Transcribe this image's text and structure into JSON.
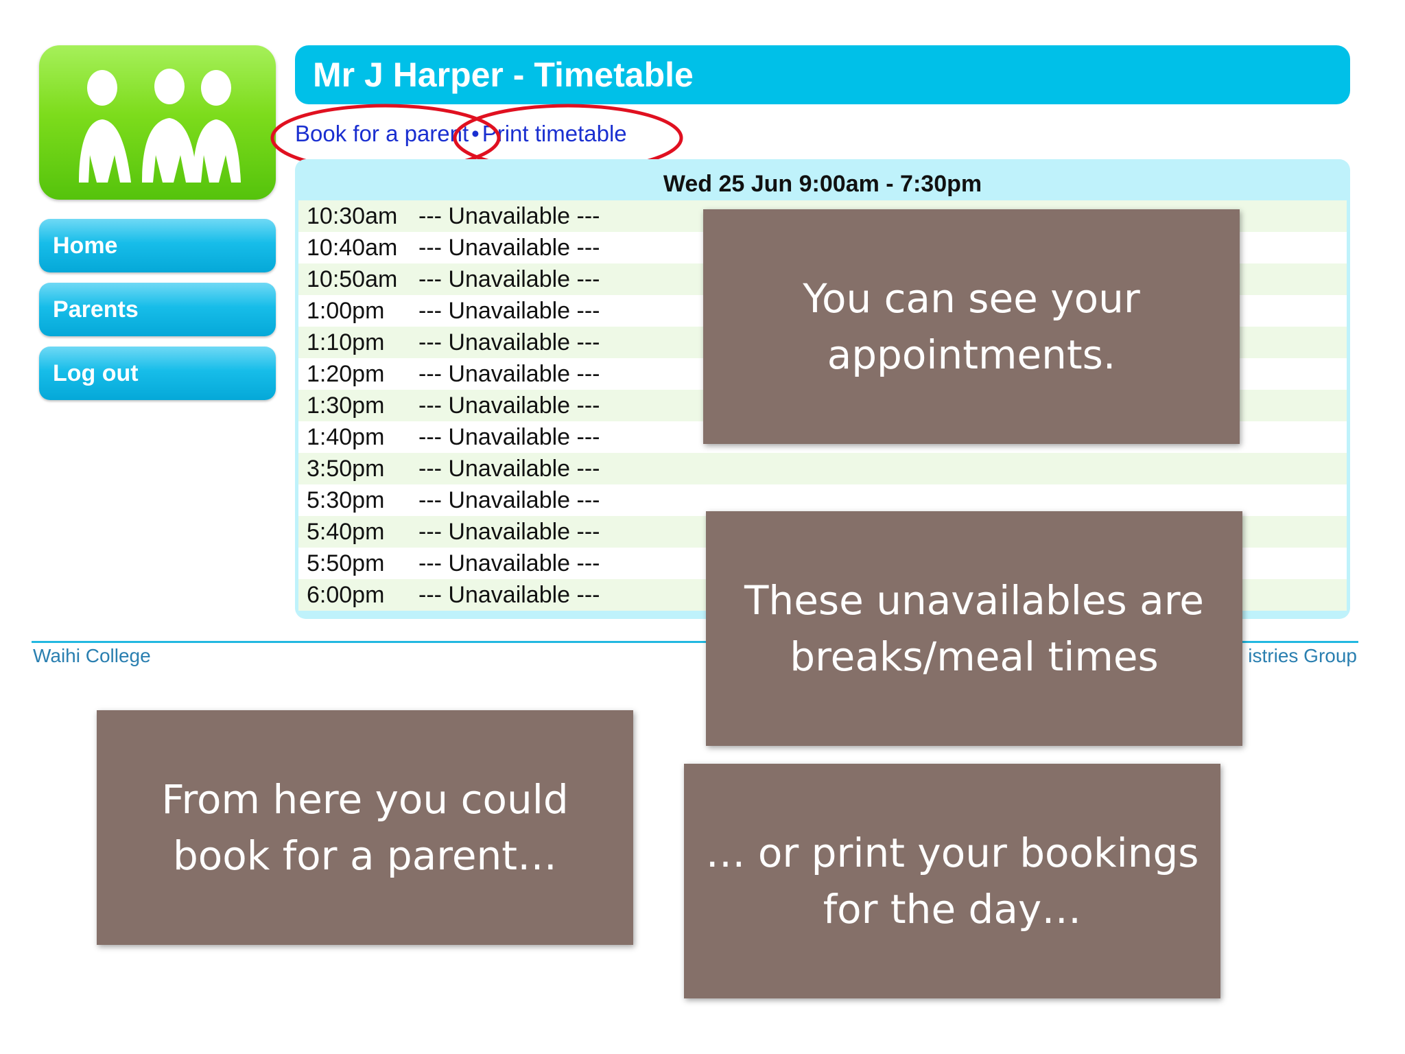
{
  "sidebar": {
    "logo_icon": "people-group-icon",
    "items": [
      {
        "label": "Home"
      },
      {
        "label": "Parents"
      },
      {
        "label": "Log out"
      }
    ]
  },
  "header": {
    "title": "Mr J Harper - Timetable"
  },
  "actions": {
    "book_label": "Book for a parent",
    "separator": "•",
    "print_label": "Print timetable"
  },
  "timetable": {
    "date_range": "Wed 25 Jun 9:00am - 7:30pm",
    "rows": [
      {
        "time": "10:30am",
        "status": "--- Unavailable ---"
      },
      {
        "time": "10:40am",
        "status": "--- Unavailable ---"
      },
      {
        "time": "10:50am",
        "status": "--- Unavailable ---"
      },
      {
        "time": "1:00pm",
        "status": "--- Unavailable ---"
      },
      {
        "time": "1:10pm",
        "status": "--- Unavailable ---"
      },
      {
        "time": "1:20pm",
        "status": "--- Unavailable ---"
      },
      {
        "time": "1:30pm",
        "status": "--- Unavailable ---"
      },
      {
        "time": "1:40pm",
        "status": "--- Unavailable ---"
      },
      {
        "time": "3:50pm",
        "status": "--- Unavailable ---"
      },
      {
        "time": "5:30pm",
        "status": "--- Unavailable ---"
      },
      {
        "time": "5:40pm",
        "status": "--- Unavailable ---"
      },
      {
        "time": "5:50pm",
        "status": "--- Unavailable ---"
      },
      {
        "time": "6:00pm",
        "status": "--- Unavailable ---"
      }
    ]
  },
  "footer": {
    "left": "Waihi College",
    "right": "istries Group"
  },
  "callouts": {
    "appointments": "You can see your appointments.",
    "unavailables": "These unavailables are breaks/meal times",
    "book": "From here you could book for a parent…",
    "print": "… or print your bookings for the day…"
  },
  "colors": {
    "title_bar": "#00c0e8",
    "annotation_circle": "#e01020",
    "callout_bg": "#857069"
  }
}
